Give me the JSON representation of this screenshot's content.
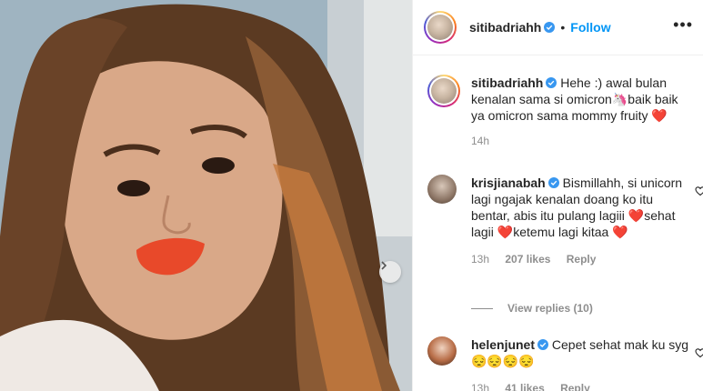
{
  "header": {
    "username": "sitibadriahh",
    "separator": "•",
    "follow_label": "Follow",
    "more_icon": "more-icon"
  },
  "caption": {
    "username": "sitibadriahh",
    "text": "Hehe :) awal bulan kenalan sama si omicron",
    "emoji_1": "🦄",
    "text_2": "baik baik ya omicron sama mommy fruity",
    "emoji_2": "❤️",
    "time": "14h"
  },
  "comments": [
    {
      "username": "krisjianabah",
      "text_1": "Bismillahh, si unicorn lagi ngajak kenalan doang ko itu bentar, abis itu pulang lagiii",
      "emoji_a": "❤️",
      "text_2": "sehat lagii",
      "emoji_b": "❤️",
      "text_3": "ketemu lagi kitaa",
      "emoji_c": "❤️",
      "time": "13h",
      "likes": "207 likes",
      "reply": "Reply",
      "view_replies": "View replies (10)"
    },
    {
      "username": "helenjunet",
      "text_1": "Cepet sehat mak ku syg",
      "emojis": "😔😔😔😔",
      "time": "13h",
      "likes": "41 likes",
      "reply": "Reply"
    }
  ],
  "colors": {
    "accent": "#0095f6",
    "verified": "#3897f0",
    "heart": "#ed4956",
    "muted": "#8e8e8e"
  }
}
